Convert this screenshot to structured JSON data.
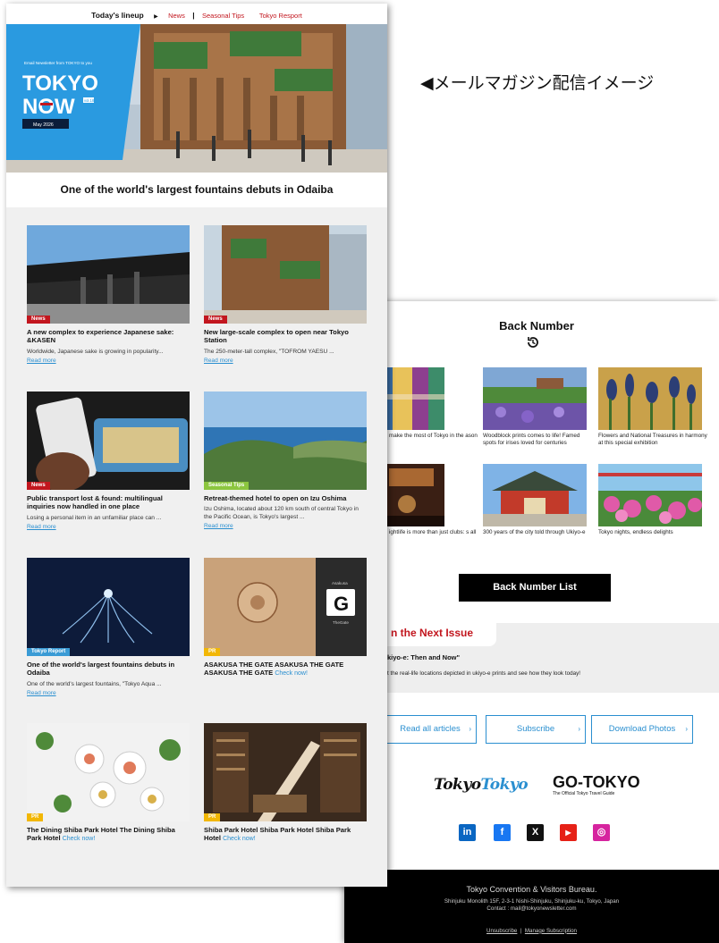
{
  "caption": "◀メールマガジン配信イメージ",
  "newsletter": {
    "lineup_label": "Today's lineup",
    "lineup_links": [
      "News",
      "Seasonal Tips",
      "Tokyo Resport"
    ],
    "hero": {
      "kicker": "Email Newsletter from TOKYO to you",
      "brand_line1": "TOKYO",
      "brand_line2": "NOW",
      "vol": "vol.182",
      "date": "May 2026"
    },
    "headline": "One of the world's largest fountains debuts in Odaiba",
    "articles": [
      {
        "tag": "News",
        "title": "A new complex to experience Japanese sake: &KASEN",
        "desc": "Worldwide, Japanese sake is growing in popularity...",
        "more": "Read more"
      },
      {
        "tag": "News",
        "title": "New large-scale complex to open near Tokyo Station",
        "desc": "The 250-meter-tall complex, \"TOFROM YAESU ...",
        "more": "Read more"
      },
      {
        "tag": "News",
        "title": "Public transport lost & found: multilingual inquiries now handled in one place",
        "desc": "Losing a personal item in an unfamiliar place can ...",
        "more": "Read more"
      },
      {
        "tag": "Seasonal Tips",
        "title": "Retreat-themed hotel to open on Izu Oshima",
        "desc": "Izu Oshima, located about 120 km south of central Tokyo in the Pacific Ocean, is Tokyo's largest ...",
        "more": "Read more"
      },
      {
        "tag": "Tokyo Report",
        "title": "One of the world's largest fountains debuts in Odaiba",
        "desc": "One of the world's largest fountains, \"Tokyo Aqua ...",
        "more": "Read more"
      },
      {
        "tag": "PR",
        "title": "ASAKUSA THE GATE ASAKUSA THE GATE ASAKUSA THE GATE",
        "cta": "Check now!"
      },
      {
        "tag": "PR",
        "title": "The Dining Shiba Park Hotel The Dining Shiba Park Hotel",
        "cta": "Check now!"
      },
      {
        "tag": "PR",
        "title": "Shiba Park Hotel Shiba Park Hotel Shiba Park Hotel",
        "cta": "Check now!"
      }
    ],
    "gate_logo": {
      "top": "Asakusa",
      "letter": "G",
      "bottom": "TheGate"
    }
  },
  "back": {
    "title": "Back Number",
    "items": [
      {
        "caption": "make the most of Tokyo in the ason"
      },
      {
        "caption": "Woodblock prints comes to life! Famed spots for irises loved for centuries"
      },
      {
        "caption": "Flowers and National Treasures in harmony at this special exhibition"
      },
      {
        "caption": "ightlife is more than just clubs: s all"
      },
      {
        "caption": "300 years of the city told through Ukiyo-e"
      },
      {
        "caption": "Tokyo nights, endless delights"
      }
    ],
    "list_button": "Back Number List",
    "next_issue_title": "n the Next Issue",
    "next_issue_sub": "kiyo-e: Then and Now\"",
    "next_issue_desc": "t the real-life locations depicted in ukiyo-e prints and see how they look today!",
    "links": [
      "Read all articles",
      "Subscribe",
      "Download Photos"
    ],
    "logo_tt_a": "Tokyo",
    "logo_tt_b": "Tokyo",
    "logo_go": "GO-TOKYO",
    "logo_go_sub": "The Official Tokyo Travel Guide",
    "social": [
      "in",
      "f",
      "X",
      "▶",
      "◎"
    ],
    "footer": {
      "org": "Tokyo Convention & Visitors Bureau.",
      "address": "Shinjuku Monolith 15F, 2-3-1 Nishi-Shinjuku, Shinjuku-ku, Tokyo, Japan",
      "contact": "Contact : mail@tokyonewsletter.com",
      "unsubscribe": "Unsubscribe",
      "manage": "Manage Subscription"
    }
  }
}
